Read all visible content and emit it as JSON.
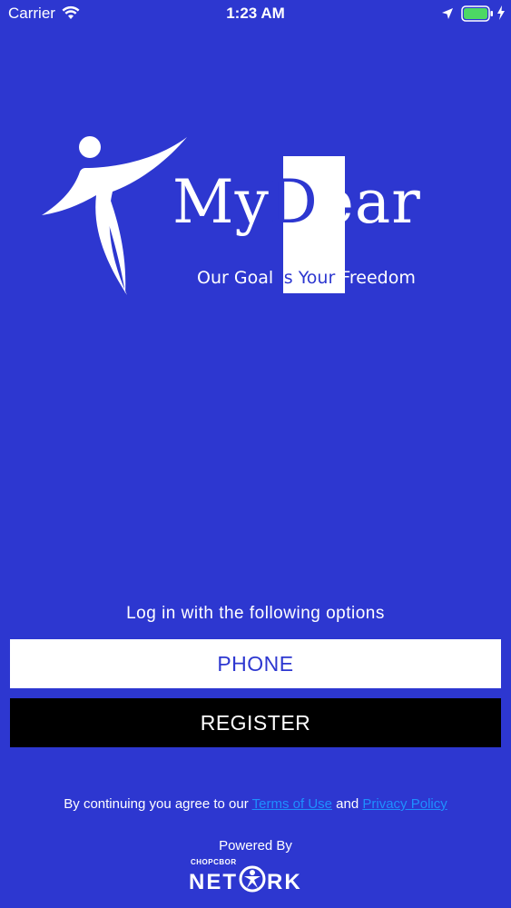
{
  "status_bar": {
    "carrier": "Carrier",
    "time": "1:23 AM",
    "wifi_icon": "wifi-icon",
    "location_icon": "location-arrow-icon",
    "battery_icon": "battery-icon",
    "charging_icon": "charging-bolt-icon",
    "battery_color": "#4cd964"
  },
  "logo": {
    "figure_icon": "running-person-icon",
    "brand_pre": "My",
    "brand_highlight": "D",
    "brand_post": "ear",
    "tagline_pre": "Our Goal ",
    "tagline_highlight": "Is Your",
    "tagline_post": " Freedom"
  },
  "login": {
    "prompt": "Log in with the following options",
    "phone_label": "PHONE",
    "register_label": "REGISTER"
  },
  "footer": {
    "agreement_pre": "By continuing you agree to our ",
    "terms_link": "Terms of Use",
    "agreement_mid": " and ",
    "privacy_link": "Privacy Policy",
    "powered_by": "Powered By",
    "network_small": "CHOPCBOR",
    "network_pre": "NET",
    "network_post": "RK",
    "network_icon": "network-figure-icon"
  },
  "colors": {
    "background": "#2d37d0",
    "link": "#1e90ff",
    "button_phone_bg": "#ffffff",
    "button_register_bg": "#000000"
  }
}
